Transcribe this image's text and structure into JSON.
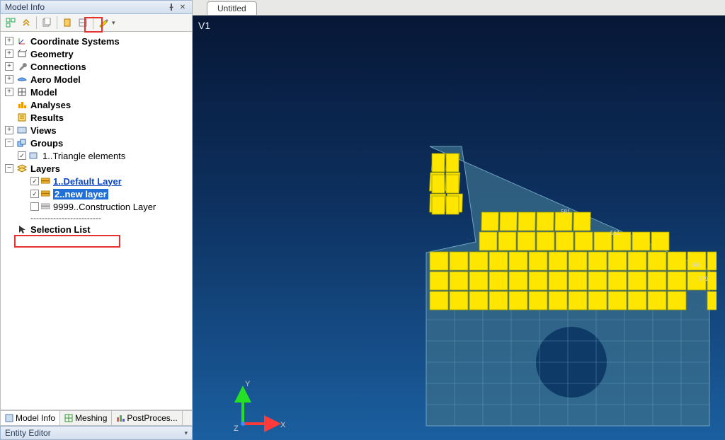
{
  "panel": {
    "title": "Model Info"
  },
  "toolbar_icons": [
    "expand",
    "collapse",
    "sep",
    "copy",
    "sep",
    "paste",
    "link",
    "sep",
    "highlight"
  ],
  "tree": {
    "roots": [
      {
        "label": "Coordinate Systems",
        "icon": "axes"
      },
      {
        "label": "Geometry",
        "icon": "geom"
      },
      {
        "label": "Connections",
        "icon": "wrench"
      },
      {
        "label": "Aero Model",
        "icon": "aero"
      },
      {
        "label": "Model",
        "icon": "grid"
      },
      {
        "label": "Analyses",
        "icon": "analyses",
        "noexp": true
      },
      {
        "label": "Results",
        "icon": "results",
        "noexp": true
      },
      {
        "label": "Views",
        "icon": "views"
      },
      {
        "label": "Groups",
        "icon": "groups",
        "open": true,
        "children": [
          {
            "label": "1..Triangle elements",
            "type": "group"
          }
        ]
      },
      {
        "label": "Layers",
        "icon": "layers",
        "open": true,
        "children": [
          {
            "label": "1..Default Layer",
            "type": "layer",
            "checked": true,
            "link": true
          },
          {
            "label": "2..new layer",
            "type": "layer",
            "checked": true,
            "selected": true
          },
          {
            "label": "9999..Construction Layer",
            "type": "layer",
            "checked": false
          }
        ]
      },
      {
        "label": "Selection List",
        "icon": "cursor",
        "noexp": true
      }
    ]
  },
  "bottom_tabs": [
    {
      "label": "Model Info",
      "active": true
    },
    {
      "label": "Meshing"
    },
    {
      "label": "PostProces..."
    }
  ],
  "entity_panel": {
    "title": "Entity Editor"
  },
  "viewport": {
    "tab": "Untitled",
    "view_label": "V1",
    "axes": {
      "x": "X",
      "y": "Y",
      "z": "Z"
    },
    "node_numbers": [
      "581",
      "561",
      "568",
      "579"
    ]
  }
}
